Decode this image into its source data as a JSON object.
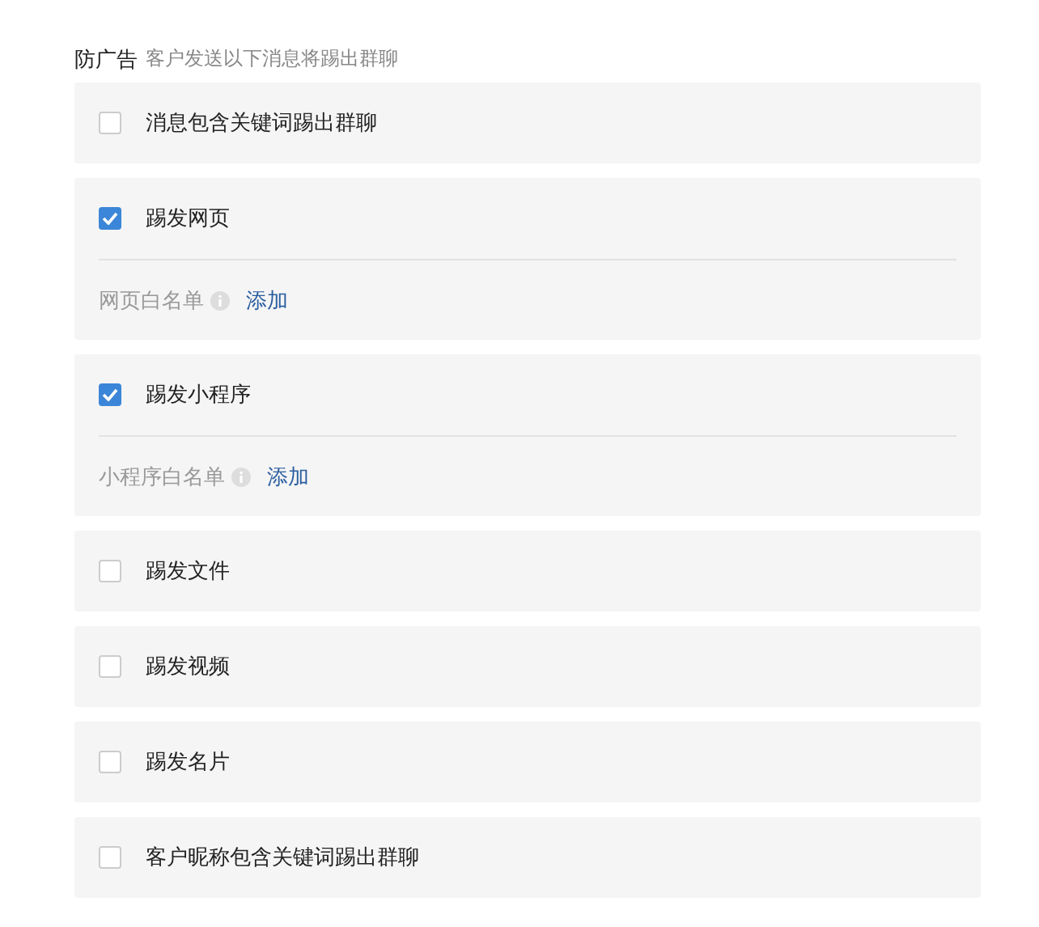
{
  "section": {
    "title": "防广告",
    "subtitle": "客户发送以下消息将踢出群聊"
  },
  "options": [
    {
      "label": "消息包含关键词踢出群聊",
      "checked": false
    },
    {
      "label": "踢发网页",
      "checked": true,
      "whitelist": {
        "label": "网页白名单",
        "action": "添加"
      }
    },
    {
      "label": "踢发小程序",
      "checked": true,
      "whitelist": {
        "label": "小程序白名单",
        "action": "添加"
      }
    },
    {
      "label": "踢发文件",
      "checked": false
    },
    {
      "label": "踢发视频",
      "checked": false
    },
    {
      "label": "踢发名片",
      "checked": false
    },
    {
      "label": "客户昵称包含关键词踢出群聊",
      "checked": false
    }
  ]
}
